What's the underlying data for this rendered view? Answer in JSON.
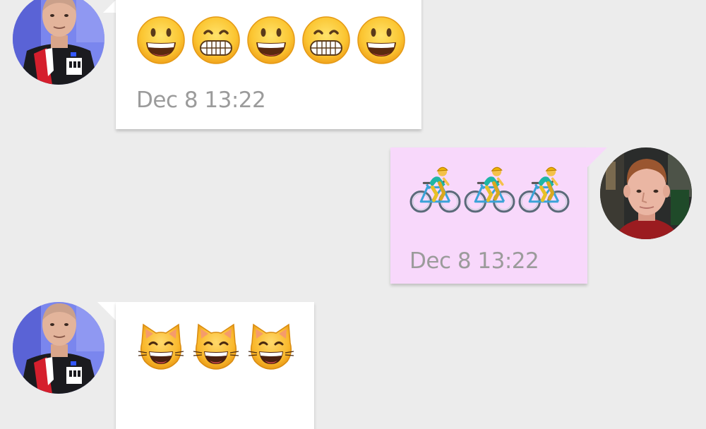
{
  "colors": {
    "background": "#ececec",
    "incoming_bubble": "#ffffff",
    "outgoing_bubble": "#f8d8fb",
    "timestamp_text": "#9b9b9b"
  },
  "messages": [
    {
      "direction": "incoming",
      "sender_avatar": "contact-avatar",
      "emojis": [
        "grinning-face",
        "grimacing-face",
        "grinning-face",
        "grimacing-face",
        "grinning-face"
      ],
      "timestamp": "Dec 8 13:22"
    },
    {
      "direction": "outgoing",
      "sender_avatar": "self-avatar",
      "emojis": [
        "bicyclist",
        "bicyclist",
        "bicyclist"
      ],
      "timestamp": "Dec 8 13:22"
    },
    {
      "direction": "incoming",
      "sender_avatar": "contact-avatar",
      "emojis": [
        "smiling-cat-face",
        "smiling-cat-face",
        "smiling-cat-face"
      ],
      "timestamp": ""
    }
  ]
}
